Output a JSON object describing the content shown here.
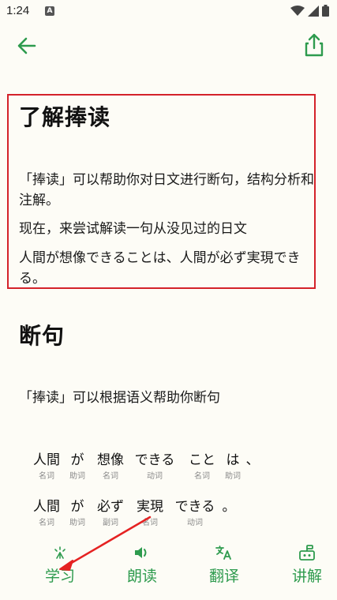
{
  "status_bar": {
    "time": "1:24",
    "notification_letter": "A"
  },
  "colors": {
    "accent": "#2e9b4e",
    "highlight_box": "#d4222a",
    "background": "#fdfcf6"
  },
  "toolbar": {
    "back_icon": "arrow-left-icon",
    "share_icon": "share-icon"
  },
  "section1": {
    "title": "了解捧读",
    "paragraphs": [
      "「捧读」可以帮助你对日文进行断句，结构分析和注解。",
      "现在，来尝试解读一句从没见过的日文",
      "人間が想像できることは、人間が必ず実現できる。"
    ]
  },
  "section2": {
    "title": "断句",
    "description": "「捧读」可以根据语义帮助你断句",
    "rows": [
      [
        {
          "word": "人間",
          "pos": "名词"
        },
        {
          "word": "が",
          "pos": "助词"
        },
        {
          "word": "想像",
          "pos": "名词"
        },
        {
          "word": "できる",
          "pos": "动词"
        },
        {
          "word": "こと",
          "pos": "名词"
        },
        {
          "word": "は",
          "pos": "助词"
        },
        {
          "word": "、",
          "pos": ""
        }
      ],
      [
        {
          "word": "人間",
          "pos": "名词"
        },
        {
          "word": "が",
          "pos": "助词"
        },
        {
          "word": "必ず",
          "pos": "副词"
        },
        {
          "word": "実現",
          "pos": "名词"
        },
        {
          "word": "できる",
          "pos": "动词"
        },
        {
          "word": "。",
          "pos": ""
        }
      ]
    ]
  },
  "bottom_nav": [
    {
      "label": "学习",
      "icon": "sparkle-icon"
    },
    {
      "label": "朗读",
      "icon": "speaker-icon"
    },
    {
      "label": "翻译",
      "icon": "translate-icon"
    },
    {
      "label": "讲解",
      "icon": "robot-icon"
    }
  ]
}
